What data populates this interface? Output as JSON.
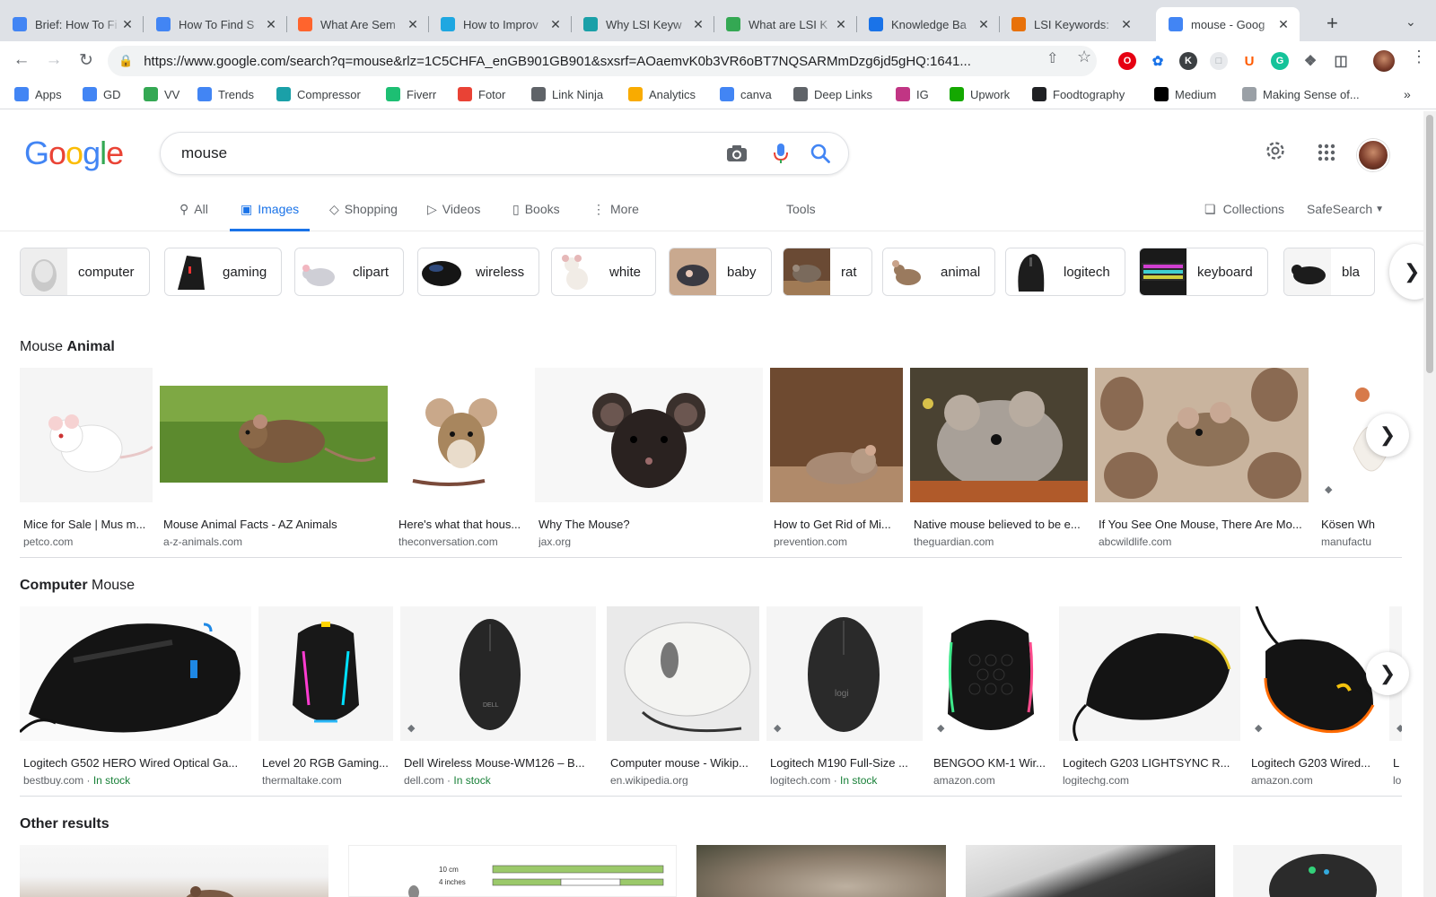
{
  "browser": {
    "tabs": [
      {
        "title": "Brief: How To Fi",
        "icon": "docs-icon",
        "color": "#4285f4"
      },
      {
        "title": "How To Find S",
        "icon": "docs-icon",
        "color": "#4285f4"
      },
      {
        "title": "What Are Sem",
        "icon": "semrush-icon",
        "color": "#ff642d"
      },
      {
        "title": "How to Improv",
        "icon": "m-icon",
        "color": "#1ea7e1"
      },
      {
        "title": "Why LSI Keyw",
        "icon": "layers-icon",
        "color": "#1aa0a8"
      },
      {
        "title": "What are LSI K",
        "icon": "circle-icon",
        "color": "#34a853"
      },
      {
        "title": "Knowledge Ba",
        "icon": "magnifier-icon",
        "color": "#1a73e8"
      },
      {
        "title": "LSI Keywords:",
        "icon": "b-icon",
        "color": "#e8710a"
      },
      {
        "title": "mouse - Goog",
        "icon": "google-icon",
        "color": "#4285f4"
      }
    ],
    "url": "https://www.google.com/search?q=mouse&rlz=1C5CHFA_enGB901GB901&sxsrf=AOaemvK0b3VR6oBT7NQSARMmDzg6jd5gHQ:1641...",
    "bookmarks": [
      {
        "label": "Apps",
        "icon": "apps-grid-icon",
        "color": "#4285f4"
      },
      {
        "label": "GD",
        "icon": "docs-icon",
        "color": "#4285f4"
      },
      {
        "label": "VV",
        "icon": "plant-icon",
        "color": "#34a853"
      },
      {
        "label": "Trends",
        "icon": "trends-icon",
        "color": "#4285f4"
      },
      {
        "label": "Compressor",
        "icon": "compressor-icon",
        "color": "#1aa0a8"
      },
      {
        "label": "Fiverr",
        "icon": "fiverr-icon",
        "color": "#1dbf73"
      },
      {
        "label": "Fotor",
        "icon": "fotor-icon",
        "color": "#e94235"
      },
      {
        "label": "Link Ninja",
        "icon": "globe-icon",
        "color": "#5f6368"
      },
      {
        "label": "Analytics",
        "icon": "analytics-icon",
        "color": "#f9ab00"
      },
      {
        "label": "canva",
        "icon": "canva-icon",
        "color": "#4285f4"
      },
      {
        "label": "Deep Links",
        "icon": "link-icon",
        "color": "#5f6368"
      },
      {
        "label": "IG",
        "icon": "instagram-icon",
        "color": "#c13584"
      },
      {
        "label": "Upwork",
        "icon": "upwork-icon",
        "color": "#14a800"
      },
      {
        "label": "Foodtography",
        "icon": "fs-icon",
        "color": "#202124"
      },
      {
        "label": "Medium",
        "icon": "medium-icon",
        "color": "#000000"
      },
      {
        "label": "Making Sense of...",
        "icon": "image-icon",
        "color": "#9aa0a6"
      }
    ]
  },
  "google": {
    "logo": [
      "G",
      "o",
      "o",
      "g",
      "l",
      "e"
    ],
    "query": "mouse",
    "nav": {
      "all": "All",
      "images": "Images",
      "shopping": "Shopping",
      "videos": "Videos",
      "books": "Books",
      "more": "More",
      "tools": "Tools",
      "collections": "Collections",
      "safesearch": "SafeSearch"
    },
    "chips": [
      "computer",
      "gaming",
      "clipart",
      "wireless",
      "white",
      "baby",
      "rat",
      "animal",
      "logitech",
      "keyboard",
      "bla"
    ],
    "sections": {
      "animal": {
        "prefix": "Mouse ",
        "bold": "Animal"
      },
      "computer": {
        "bold": "Computer",
        "suffix": " Mouse"
      },
      "other": {
        "bold": "Other results"
      }
    },
    "animal_results": [
      {
        "caption": "Mice for Sale | Mus m...",
        "source": "petco.com"
      },
      {
        "caption": "Mouse Animal Facts - AZ Animals",
        "source": "a-z-animals.com"
      },
      {
        "caption": "Here's what that hous...",
        "source": "theconversation.com"
      },
      {
        "caption": "Why The Mouse?",
        "source": "jax.org"
      },
      {
        "caption": "How to Get Rid of Mi...",
        "source": "prevention.com"
      },
      {
        "caption": "Native mouse believed to be e...",
        "source": "theguardian.com"
      },
      {
        "caption": "If You See One Mouse, There Are Mo...",
        "source": "abcwildlife.com"
      },
      {
        "caption": "Kösen Wh",
        "source": "manufactu"
      }
    ],
    "computer_results": [
      {
        "caption": "Logitech G502 HERO Wired Optical Ga...",
        "source": "bestbuy.com",
        "stock": "In stock"
      },
      {
        "caption": "Level 20 RGB Gaming...",
        "source": "thermaltake.com",
        "stock": ""
      },
      {
        "caption": "Dell Wireless Mouse-WM126 – B...",
        "source": "dell.com",
        "stock": "In stock"
      },
      {
        "caption": "Computer mouse - Wikip...",
        "source": "en.wikipedia.org",
        "stock": ""
      },
      {
        "caption": "Logitech M190 Full-Size ...",
        "source": "logitech.com",
        "stock": "In stock"
      },
      {
        "caption": "BENGOO KM-1 Wir...",
        "source": "amazon.com",
        "stock": ""
      },
      {
        "caption": "Logitech G203 LIGHTSYNC R...",
        "source": "logitechg.com",
        "stock": ""
      },
      {
        "caption": "Logitech G203 Wired...",
        "source": "amazon.com",
        "stock": ""
      },
      {
        "caption": "L",
        "source": "lo",
        "stock": ""
      }
    ],
    "stock_separator": " · "
  }
}
